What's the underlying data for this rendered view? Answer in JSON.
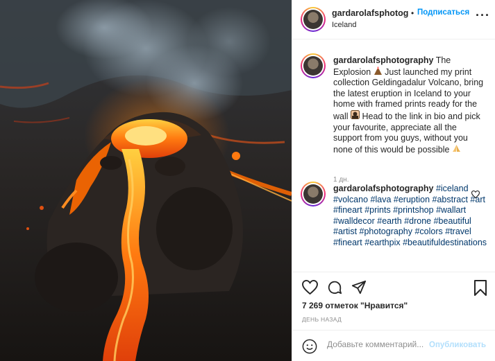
{
  "post": {
    "image_alt": "Erupting volcano with lava flow, Geldingadalur, Iceland"
  },
  "header": {
    "username": "gardarolafsphotog",
    "dot": "•",
    "follow_label": "Подписаться",
    "location": "Iceland",
    "more_icon": "more-horizontal-icon"
  },
  "caption": {
    "username": "gardarolafsphotography",
    "text_1": " The Explosion ",
    "emoji_1": "volcano-emoji",
    "text_2": " Just launched my print collection Geldingadalur Volcano, bring the latest eruption in Iceland to your home with framed prints ready for the wall ",
    "emoji_2": "woman-frame-emoji",
    "text_3": " Head to the link in bio and pick your favourite, appreciate all the support from you guys, without you none of this would be possible ",
    "emoji_3": "folded-hands-emoji",
    "time": "1 дн."
  },
  "comment": {
    "username": "gardarolafsphotography",
    "hashtags": [
      "#iceland",
      "#volcano",
      "#lava",
      "#eruption",
      "#abstract",
      "#art",
      "#fineart",
      "#prints",
      "#printshop",
      "#wallart",
      "#walldecor",
      "#earth",
      "#drone",
      "#beautiful",
      "#artist",
      "#photography",
      "#colors",
      "#travel",
      "#fineart",
      "#earthpix",
      "#beautifuldestinations"
    ]
  },
  "actions": {
    "likes": "7 269 отметок \"Нравится\"",
    "date": "ДЕНЬ НАЗАД"
  },
  "add_comment": {
    "placeholder": "Добавьте комментарий...",
    "publish_label": "Опубликовать"
  },
  "colors": {
    "accent": "#0095f6",
    "hashtag": "#00376b",
    "publish_disabled": "#b2dffc",
    "lava": "#ff6a00"
  }
}
